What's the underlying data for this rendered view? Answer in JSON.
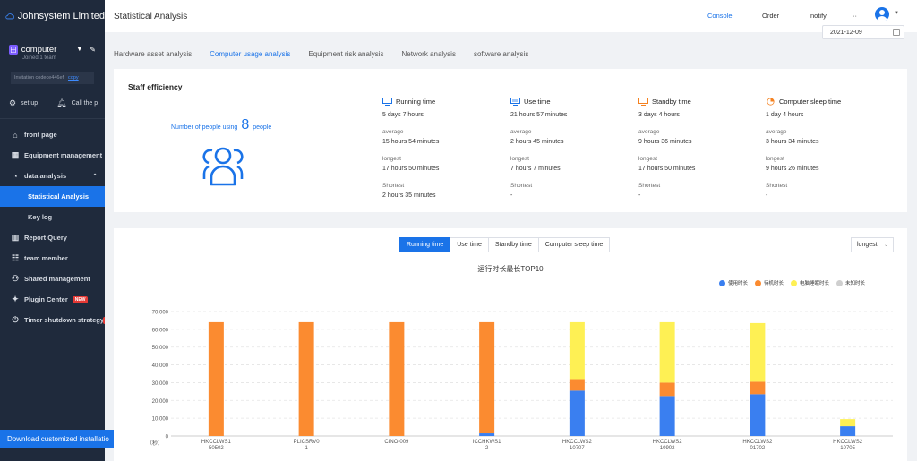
{
  "brand": {
    "name": "Johnsystem Limited"
  },
  "team": {
    "icon_letter": "田",
    "name": "computer",
    "sub": "Joined 1 team",
    "invite_code": "Invitation codece446ef",
    "copy_label": "copy"
  },
  "quick": {
    "setup": "set up",
    "call": "Call the p"
  },
  "nav": {
    "front_page": "front page",
    "equipment": "Equipment management",
    "data_analysis": "data analysis",
    "statistical": "Statistical Analysis",
    "key_log": "Key log",
    "report": "Report Query",
    "team_member": "team member",
    "shared": "Shared management",
    "plugin": "Plugin Center",
    "plugin_badge": "NEW",
    "timer": "Timer shutdown strategy"
  },
  "download": "Download customized installatio",
  "header": {
    "title": "Statistical Analysis",
    "console": "Console",
    "order": "Order",
    "notify": "notify",
    "dots": "··",
    "date": "2021-12-09"
  },
  "tabs": [
    "Hardware asset analysis",
    "Computer usage analysis",
    "Equipment risk analysis",
    "Network analysis",
    "software analysis"
  ],
  "efficiency": {
    "title": "Staff efficiency",
    "people_prefix": "Number of people using",
    "people_count": "8",
    "people_suffix": "people",
    "labels": {
      "average": "average",
      "longest": "longest",
      "shortest": "Shortest"
    },
    "stats": [
      {
        "title": "Running time",
        "icon": "monitor-icon",
        "total": "5 days 7 hours",
        "average": "15 hours 54 minutes",
        "longest": "17 hours 50 minutes",
        "shortest": "2 hours 35 minutes"
      },
      {
        "title": "Use time",
        "icon": "monitor-screen-icon",
        "total": "21 hours 57 minutes",
        "average": "2 hours 45 minutes",
        "longest": "7 hours 7 minutes",
        "shortest": "-"
      },
      {
        "title": "Standby time",
        "icon": "standby-monitor-icon",
        "total": "3 days 4 hours",
        "average": "9 hours 36 minutes",
        "longest": "17 hours 50 minutes",
        "shortest": "-"
      },
      {
        "title": "Computer sleep time",
        "icon": "pie-clock-icon",
        "total": "1 day 4 hours",
        "average": "3 hours 34 minutes",
        "longest": "9 hours 26 minutes",
        "shortest": "-"
      }
    ]
  },
  "chart_controls": {
    "buttons": [
      "Running time",
      "Use time",
      "Standby time",
      "Computer sleep time"
    ],
    "active": 0,
    "select_value": "longest"
  },
  "chart_data": {
    "type": "bar",
    "stacked": true,
    "title": "运行时长最长TOP10",
    "ylabel": "（秒）",
    "ylim": [
      0,
      70000
    ],
    "yticks": [
      0,
      10000,
      20000,
      30000,
      40000,
      50000,
      60000,
      70000
    ],
    "ytick_labels": [
      "0",
      "10,000",
      "20,000",
      "30,000",
      "40,000",
      "50,000",
      "60,000",
      "70,000"
    ],
    "categories": [
      [
        "HKCCLWS1",
        "50502"
      ],
      [
        "PLICSRV0",
        "1"
      ],
      [
        "CINO-009",
        ""
      ],
      [
        "ICCHKWS1",
        "2"
      ],
      [
        "HKCCLWS2",
        "10707"
      ],
      [
        "HKCCLWS2",
        "10902"
      ],
      [
        "HKCCLWS2",
        "01702"
      ],
      [
        "HKCCLWS2",
        "10705"
      ]
    ],
    "legend_position": "top-right",
    "grid": true,
    "series": [
      {
        "name": "使用时长",
        "color": "#3a7ff0",
        "values": [
          0,
          0,
          0,
          1500,
          25500,
          22500,
          23500,
          5500
        ]
      },
      {
        "name": "待机时长",
        "color": "#fb8b30",
        "values": [
          64000,
          64000,
          64000,
          62500,
          6500,
          7500,
          7000,
          0
        ]
      },
      {
        "name": "电脑睡眠时长",
        "color": "#fef054",
        "values": [
          0,
          0,
          0,
          0,
          32000,
          34000,
          33000,
          4000
        ]
      },
      {
        "name": "未知时长",
        "color": "#cfcfcf",
        "values": [
          0,
          0,
          0,
          0,
          0,
          0,
          0,
          0
        ]
      }
    ]
  }
}
